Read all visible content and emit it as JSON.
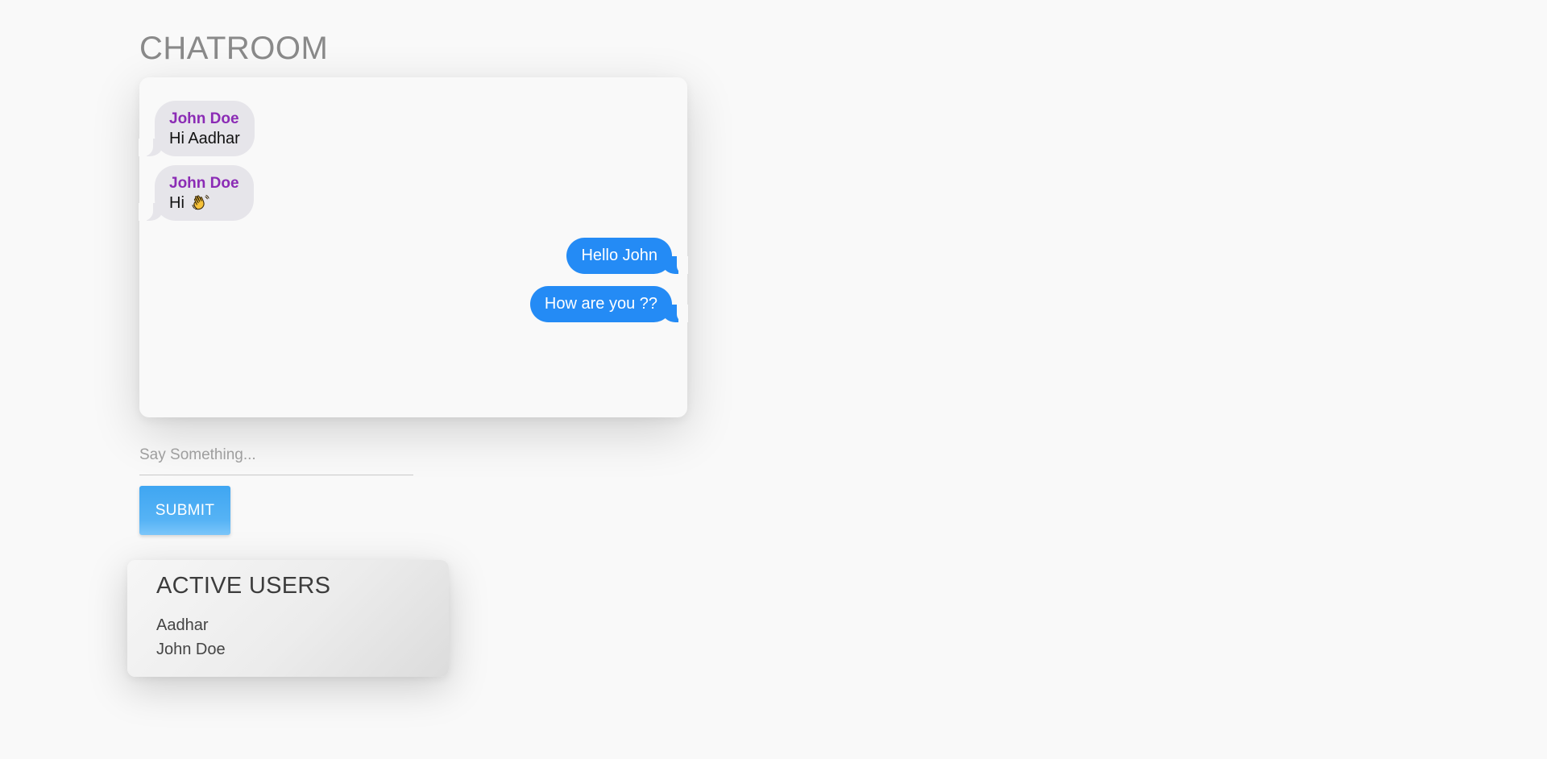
{
  "header": {
    "title": "CHATROOM"
  },
  "messages": [
    {
      "direction": "incoming",
      "sender": "John Doe",
      "text": "Hi Aadhar"
    },
    {
      "direction": "incoming",
      "sender": "John Doe",
      "text": "Hi",
      "emoji": "waving-hand-icon"
    },
    {
      "direction": "outgoing",
      "text": "Hello John"
    },
    {
      "direction": "outgoing",
      "text": "How are you ??"
    }
  ],
  "composer": {
    "placeholder": "Say Something...",
    "value": "",
    "submit_label": "SUBMIT"
  },
  "active_users": {
    "title": "ACTIVE USERS",
    "users": [
      "Aadhar",
      "John Doe"
    ]
  },
  "colors": {
    "incoming_bubble": "#e6e5ea",
    "incoming_sender": "#8b2bb5",
    "outgoing_bubble": "#248bf5",
    "submit_button": "#4aaef4"
  }
}
